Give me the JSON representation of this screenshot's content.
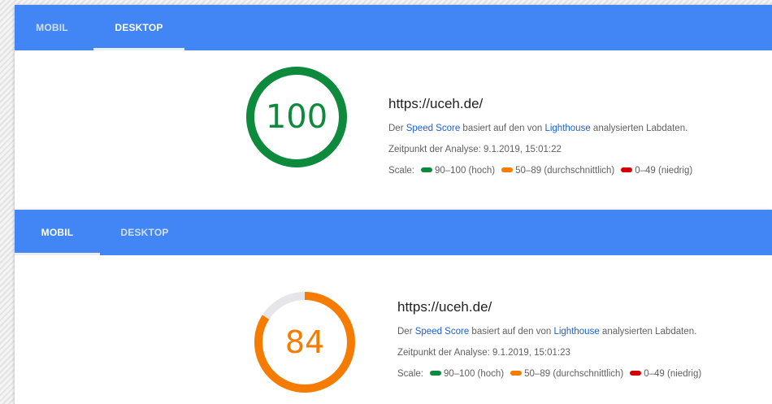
{
  "panels": [
    {
      "tabs": [
        {
          "label": "MOBIL"
        },
        {
          "label": "DESKTOP"
        }
      ],
      "active_tab": "DESKTOP",
      "score": "100",
      "score_fraction": 1.0,
      "score_color": "#0d8a3b",
      "url": "https://uceh.de/",
      "desc_prefix": "Der ",
      "speed_score_link": "Speed Score",
      "desc_middle": " basiert auf den von ",
      "lighthouse_link": "Lighthouse",
      "desc_suffix": " analysierten Labdaten.",
      "timestamp": "Zeitpunkt der Analyse: 9.1.2019, 15:01:22",
      "scale_label": "Scale:",
      "scale": [
        {
          "label": "90–100 (hoch)",
          "color": "#0d8a3b"
        },
        {
          "label": "50–89 (durchschnittlich)",
          "color": "#f57c00"
        },
        {
          "label": "0–49 (niedrig)",
          "color": "#d50000"
        }
      ]
    },
    {
      "tabs": [
        {
          "label": "MOBIL"
        },
        {
          "label": "DESKTOP"
        }
      ],
      "active_tab": "MOBIL",
      "score": "84",
      "score_fraction": 0.84,
      "score_color": "#f57c00",
      "url": "https://uceh.de/",
      "desc_prefix": "Der ",
      "speed_score_link": "Speed Score",
      "desc_middle": " basiert auf den von ",
      "lighthouse_link": "Lighthouse",
      "desc_suffix": " analysierten Labdaten.",
      "timestamp": "Zeitpunkt der Analyse: 9.1.2019, 15:01:23",
      "scale_label": "Scale:",
      "scale": [
        {
          "label": "90–100 (hoch)",
          "color": "#0d8a3b"
        },
        {
          "label": "50–89 (durchschnittlich)",
          "color": "#f57c00"
        },
        {
          "label": "0–49 (niedrig)",
          "color": "#d50000"
        }
      ]
    }
  ],
  "colors": {
    "tabbar": "#4285f4",
    "gauge_track": "#e6e6ea"
  }
}
